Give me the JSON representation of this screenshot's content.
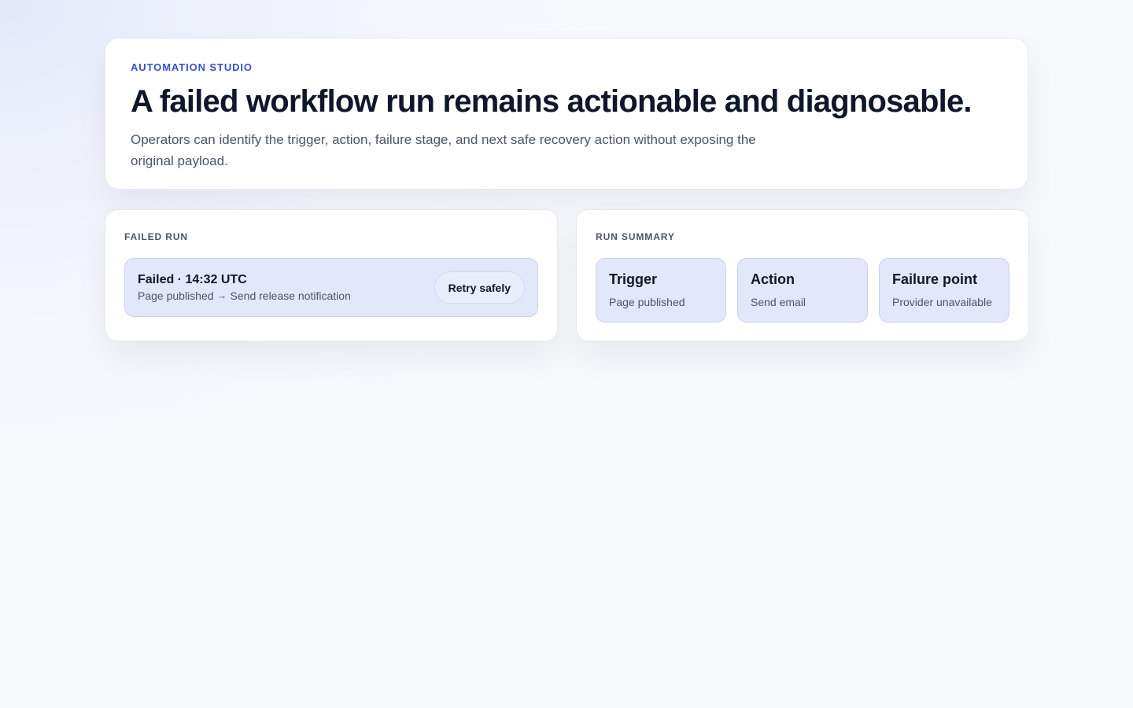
{
  "header": {
    "eyebrow": "AUTOMATION STUDIO",
    "title": "A failed workflow run remains actionable and diagnosable.",
    "description": "Operators can identify the trigger, action, failure stage, and next safe recovery action without exposing the original payload."
  },
  "failed_run": {
    "label": "FAILED RUN",
    "status": "Failed · 14:32 UTC",
    "trigger": "Page published",
    "arrow_icon": "arrow-right-icon",
    "action": "Send release notification",
    "retry_label": "Retry safely"
  },
  "run_summary": {
    "label": "RUN SUMMARY",
    "items": [
      {
        "title": "Trigger",
        "value": "Page published"
      },
      {
        "title": "Action",
        "value": "Send email"
      },
      {
        "title": "Failure point",
        "value": "Provider unavailable"
      }
    ]
  },
  "colors": {
    "accent": "#3550c8",
    "card_fill": "#e2e7f9",
    "card_border": "#c9d1ef",
    "text_primary": "#0f172a",
    "text_muted": "#4b5567"
  }
}
